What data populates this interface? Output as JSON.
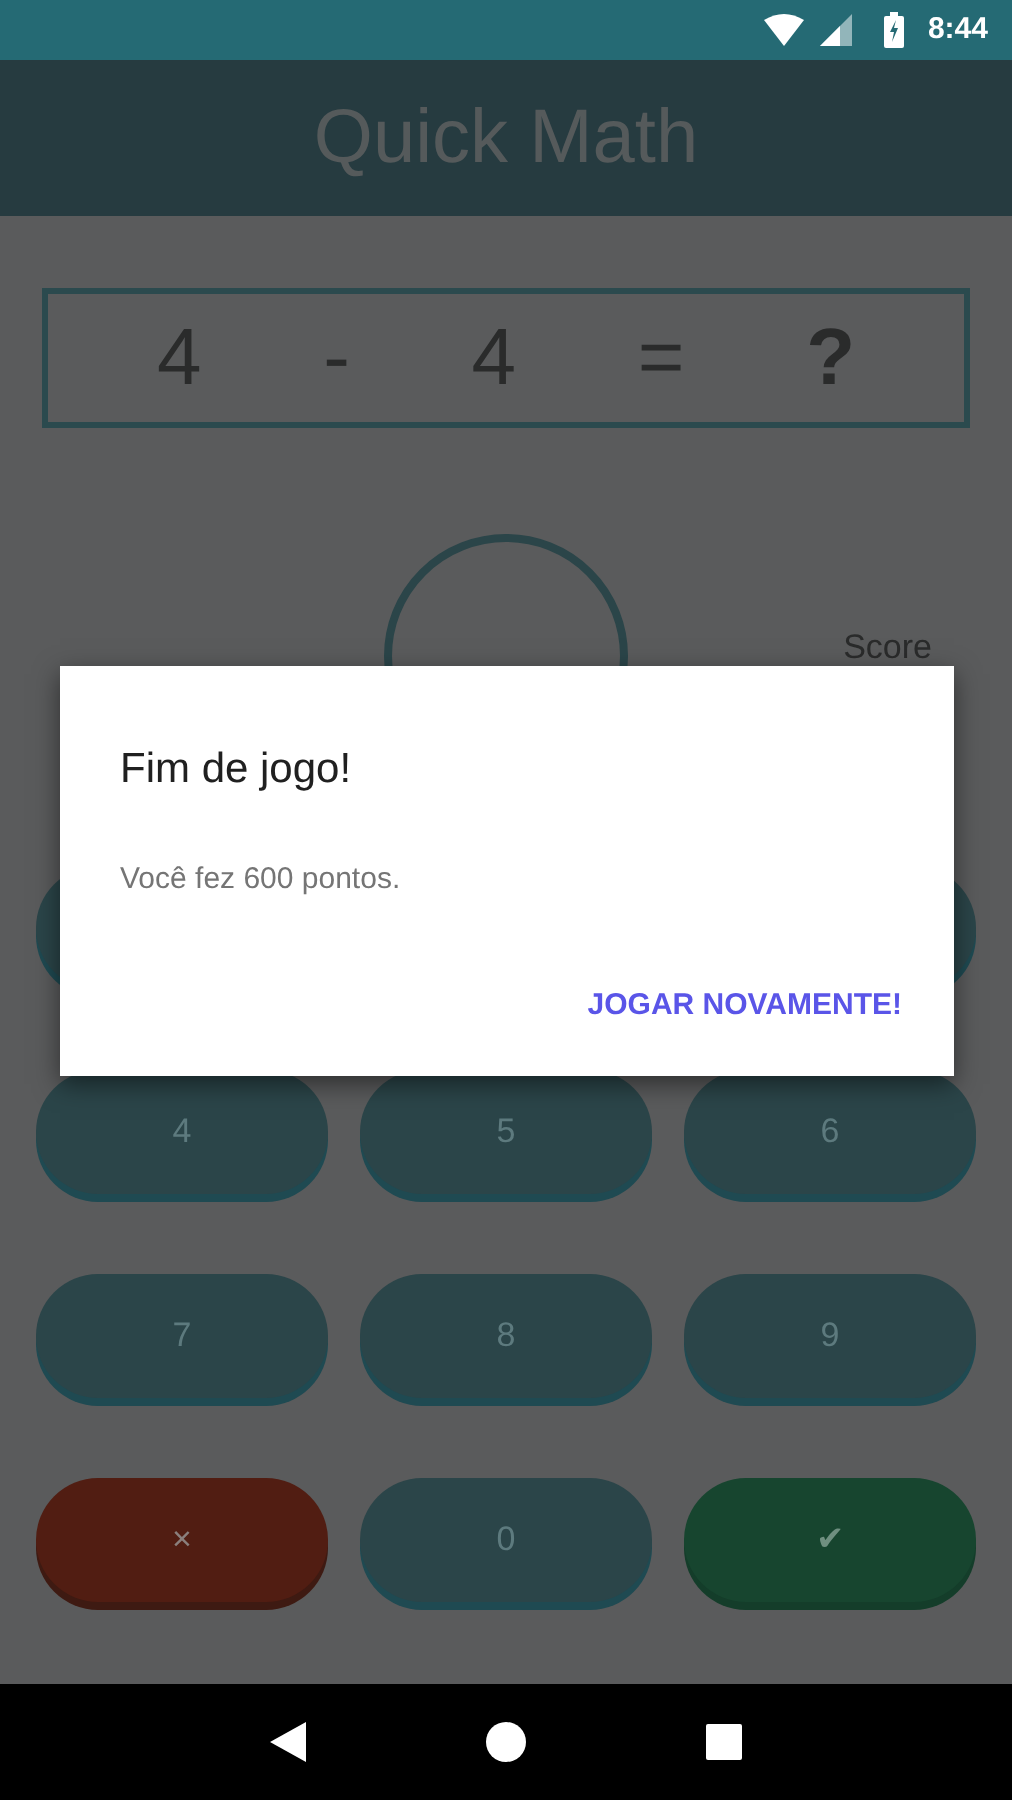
{
  "status_bar": {
    "time": "8:44"
  },
  "app_bar": {
    "title": "Quick Math"
  },
  "equation": [
    "4",
    "-",
    "4",
    "=",
    "?"
  ],
  "score": {
    "label": "Score"
  },
  "keypad": [
    [
      {
        "kind": "digit"
      },
      {
        "kind": "digit"
      }
    ],
    [
      {
        "kind": "digit",
        "label": "4"
      },
      {
        "kind": "digit",
        "label": "5"
      },
      {
        "kind": "digit",
        "label": "6"
      }
    ],
    [
      {
        "kind": "digit",
        "label": "7"
      },
      {
        "kind": "digit",
        "label": "8"
      },
      {
        "kind": "digit",
        "label": "9"
      }
    ],
    [
      {
        "kind": "clear",
        "label": "×"
      },
      {
        "kind": "digit",
        "label": "0"
      },
      {
        "kind": "submit",
        "label": "✔"
      }
    ]
  ],
  "dialog": {
    "title": "Fim de jogo!",
    "message": "Você fez 600 pontos.",
    "action": "JOGAR NOVAMENTE!"
  }
}
